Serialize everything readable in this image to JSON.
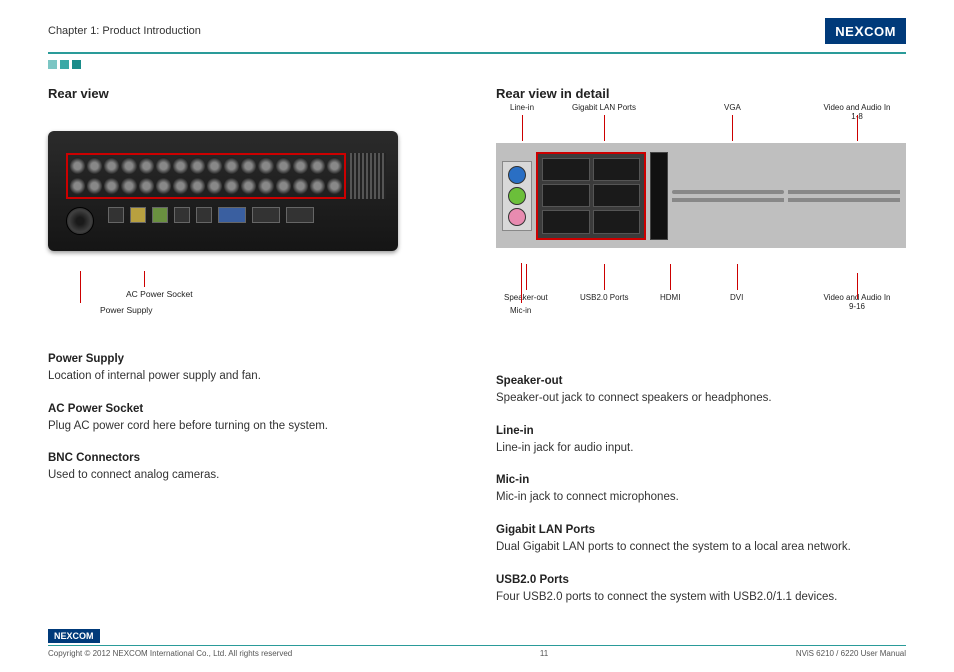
{
  "header": {
    "chapter": "Chapter 1: Product Introduction",
    "logo": "NEXCOM"
  },
  "left": {
    "heading": "Rear view",
    "callouts": {
      "bnc": "BNC Connectors",
      "ac": "AC Power Socket",
      "psu": "Power Supply"
    },
    "blocks": [
      {
        "title": "Power Supply",
        "text": "Location of internal power supply and fan."
      },
      {
        "title": "AC Power Socket",
        "text": "Plug AC power cord here before turning on the system."
      },
      {
        "title": "BNC Connectors",
        "text": "Used to connect analog cameras."
      }
    ]
  },
  "right": {
    "heading": "Rear view in detail",
    "top_labels": {
      "line_in": "Line-in",
      "lan": "Gigabit LAN Ports",
      "vga": "VGA",
      "vid_a": "Video and Audio In 1-8"
    },
    "bot_labels": {
      "speaker": "Speaker-out",
      "mic": "Mic-in",
      "usb": "USB2.0 Ports",
      "hdmi": "HDMI",
      "dvi": "DVI",
      "vid_b": "Video and Audio In 9-16"
    },
    "blocks": [
      {
        "title": "Speaker-out",
        "text": "Speaker-out jack to connect speakers or headphones."
      },
      {
        "title": "Line-in",
        "text": "Line-in jack for audio input."
      },
      {
        "title": "Mic-in",
        "text": "Mic-in jack to connect microphones."
      },
      {
        "title": "Gigabit LAN Ports",
        "text": "Dual Gigabit LAN ports to connect the system to a local area network."
      },
      {
        "title": "USB2.0 Ports",
        "text": "Four USB2.0 ports to connect the system with USB2.0/1.1 devices."
      }
    ]
  },
  "footer": {
    "logo": "NEXCOM",
    "copyright": "Copyright © 2012 NEXCOM International Co., Ltd. All rights reserved",
    "page": "11",
    "doc": "NViS 6210 / 6220 User Manual"
  }
}
